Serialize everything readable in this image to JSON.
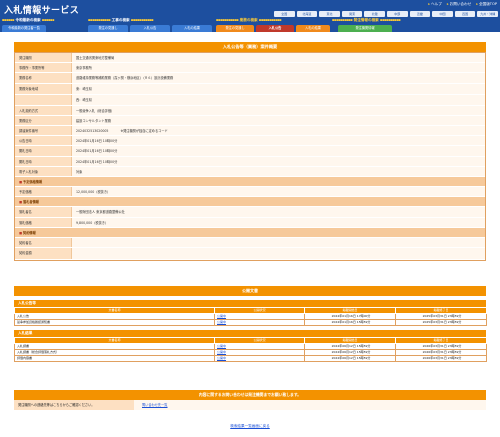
{
  "header": {
    "logo": "入札情報サービス",
    "util_links": [
      "ヘルプ",
      "お問い合わせ",
      "全国版TOP"
    ],
    "regions": [
      "全国",
      "北海道",
      "東北",
      "関東",
      "北陸",
      "中部",
      "近畿",
      "中国",
      "四国",
      "九州・沖縄"
    ]
  },
  "categories": [
    "令和最新の検索",
    "工事の検索",
    "業務の検索",
    "発注情報の検索"
  ],
  "tabs": [
    "令和最新の発注者一覧",
    "発注の見通し",
    "入札公告",
    "入札の結果",
    "発注の見通し",
    "入札公告",
    "入札の結果",
    "発注機関情報"
  ],
  "main": {
    "title": "入札公告等（業務）案件概要",
    "rows": [
      {
        "label": "発注機関",
        "value": "国土交通省関東地方整備局"
      },
      {
        "label": "事務所・事業所等",
        "value": "東京事務所"
      },
      {
        "label": "業務名称",
        "value": "道路維持業務等補助業務（霞ヶ関・横浜地区）（Ｒ６）設計設備業務"
      },
      {
        "label": "業務対象地域",
        "value": "東：埼玉県"
      },
      {
        "label": "",
        "value": "西：埼玉県"
      },
      {
        "label": "入札契約方式",
        "value": "一般競争入札（総合評価）"
      },
      {
        "label": "業務区分",
        "value": "建設コンサルタント業務"
      },
      {
        "label": "調達案件番号",
        "value": "2024032513020005",
        "note": "※発注機関が独自に定めるコード"
      },
      {
        "label": "公告日時",
        "value": "2024年01月16日 10時00分"
      },
      {
        "label": "開札日時",
        "value": "2024年01月16日 10時00分"
      },
      {
        "label": "開札日時",
        "value": "2024年01月16日 10時00分"
      },
      {
        "label": "電子入札対象",
        "value": "対象"
      }
    ],
    "section_plan": "予定価格情報",
    "plan_label": "予定価格",
    "plan_value": "12,000,000（税抜き）",
    "section_winner": "落札者情報",
    "winner_rows": [
      {
        "label": "落札者名",
        "value": "一般財団法人 東京都道路整備公社"
      },
      {
        "label": "落札価格",
        "value": "9,800,000（税抜き）"
      }
    ],
    "section_contract": "契約情報",
    "contract_rows": [
      {
        "label": "契約者名",
        "value": ""
      },
      {
        "label": "契約金額",
        "value": ""
      }
    ]
  },
  "documents": {
    "title": "公開文書",
    "columns": [
      "文書名称",
      "公開状況",
      "掲載開始日",
      "掲載終了日"
    ],
    "announce_title": "入札公告等",
    "announce_rows": [
      {
        "name": "入札公告",
        "status": "公開中",
        "start": "2024年01月16日 17時00分",
        "end": "2025年03月31日 23時59分"
      },
      {
        "name": "競争参加資格確認通知書",
        "status": "公開中",
        "start": "2024年01月16日 15時59分",
        "end": "2025年03月31日 23時59分"
      }
    ],
    "result_title": "入札結果",
    "result_rows": [
      {
        "name": "入札調書",
        "status": "公開中",
        "start": "2024年06月12日 15時59分",
        "end": "2026年03月31日 23時59分"
      },
      {
        "name": "入札調書（総合評価落札方式）",
        "status": "公開中",
        "start": "2024年06月12日 15時59分",
        "end": "2026年03月31日 23時59分"
      },
      {
        "name": "評価内容書",
        "status": "公開中",
        "start": "2024年06月12日 15時59分",
        "end": "2026年03月31日 23時59分"
      }
    ]
  },
  "contact": {
    "title": "内容に関するお問い合わせは発注機関までお願い致します。",
    "label": "発注機関への連絡先等はこちらからご確認ください。",
    "link": "問い合わせ先一覧"
  },
  "back_link": "検索結果一覧画面に戻る"
}
